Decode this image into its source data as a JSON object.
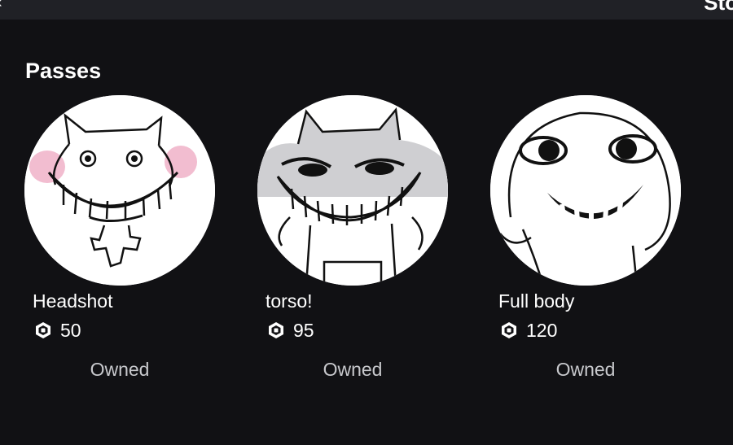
{
  "header": {
    "back_glyph": "‹",
    "tab_label": "Sto"
  },
  "section": {
    "title": "Passes"
  },
  "passes": [
    {
      "name": "Headshot",
      "price": "50",
      "status": "Owned",
      "image": "headshot-smiling-cat-drawing"
    },
    {
      "name": "torso!",
      "price": "95",
      "status": "Owned",
      "image": "torso-grinning-cat-drawing"
    },
    {
      "name": "Full body",
      "price": "120",
      "status": "Owned",
      "image": "full-body-smiling-face-drawing"
    }
  ],
  "icons": {
    "currency": "robux-icon"
  },
  "colors": {
    "background": "#111114",
    "topbar": "#202126",
    "owned_text": "#c8c9cd"
  }
}
